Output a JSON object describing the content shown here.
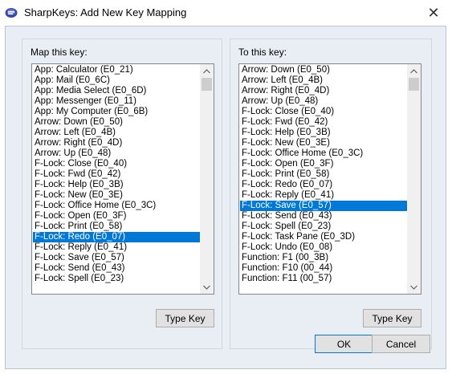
{
  "window": {
    "title": "SharpKeys: Add New Key Mapping",
    "close_glyph": "✕",
    "icon": "keyboard-icon"
  },
  "left_group": {
    "label": "Map this key:",
    "selected_index": 16,
    "items": [
      "App: Calculator (E0_21)",
      "App: Mail (E0_6C)",
      "App: Media Select (E0_6D)",
      "App: Messenger (E0_11)",
      "App: My Computer (E0_6B)",
      "Arrow: Down (E0_50)",
      "Arrow: Left (E0_4B)",
      "Arrow: Right (E0_4D)",
      "Arrow: Up (E0_48)",
      "F-Lock: Close (E0_40)",
      "F-Lock: Fwd (E0_42)",
      "F-Lock: Help (E0_3B)",
      "F-Lock: New (E0_3E)",
      "F-Lock: Office Home (E0_3C)",
      "F-Lock: Open (E0_3F)",
      "F-Lock: Print (E0_58)",
      "F-Lock: Redo (E0_07)",
      "F-Lock: Reply (E0_41)",
      "F-Lock: Save (E0_57)",
      "F-Lock: Send (E0_43)",
      "F-Lock: Spell (E0_23)"
    ],
    "type_key_label": "Type Key"
  },
  "right_group": {
    "label": "To this key:",
    "selected_index": 13,
    "items": [
      "Arrow: Down (E0_50)",
      "Arrow: Left (E0_4B)",
      "Arrow: Right (E0_4D)",
      "Arrow: Up (E0_48)",
      "F-Lock: Close (E0_40)",
      "F-Lock: Fwd (E0_42)",
      "F-Lock: Help (E0_3B)",
      "F-Lock: New (E0_3E)",
      "F-Lock: Office Home (E0_3C)",
      "F-Lock: Open (E0_3F)",
      "F-Lock: Print (E0_58)",
      "F-Lock: Redo (E0_07)",
      "F-Lock: Reply (E0_41)",
      "F-Lock: Save (E0_57)",
      "F-Lock: Send (E0_43)",
      "F-Lock: Spell (E0_23)",
      "F-Lock: Task Pane (E0_3D)",
      "F-Lock: Undo (E0_08)",
      "Function: F1 (00_3B)",
      "Function: F10 (00_44)",
      "Function: F11 (00_57)"
    ],
    "type_key_label": "Type Key"
  },
  "footer": {
    "ok_label": "OK",
    "cancel_label": "Cancel"
  },
  "colors": {
    "selection": "#0078d7",
    "dialog_bg": "#e9eef5"
  }
}
